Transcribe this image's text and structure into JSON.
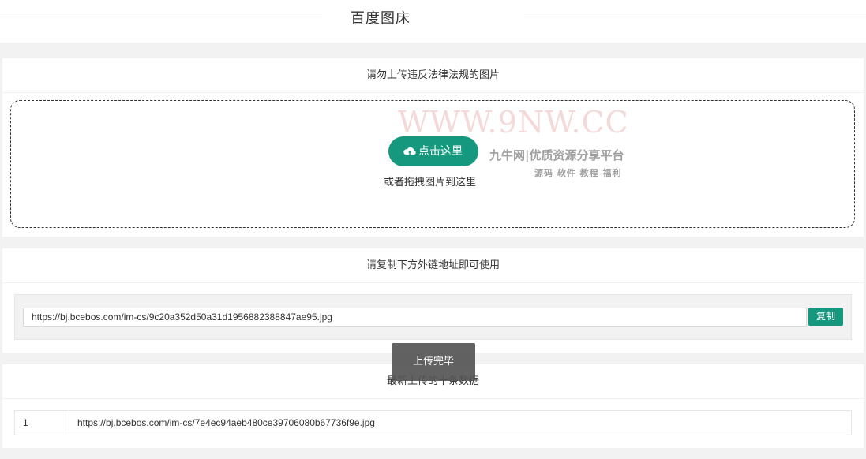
{
  "header": {
    "title": "百度图床"
  },
  "upload": {
    "notice": "请勿上传违反法律法规的图片",
    "button_label": "点击这里",
    "drag_hint": "或者拖拽图片到这里",
    "watermark_main": "WWW.9NW.CC",
    "watermark_sub": "九牛网|优质资源分享平台",
    "watermark_tags": "源码 软件 教程 福利"
  },
  "link": {
    "notice": "请复制下方外链地址即可使用",
    "url_value": "https://bj.bcebos.com/im-cs/9c20a352d50a31d1956882388847ae95.jpg",
    "copy_label": "复制"
  },
  "toast": {
    "message": "上传完毕"
  },
  "recent": {
    "title": "最新上传的十条数据",
    "rows": [
      {
        "index": "1",
        "url": "https://bj.bcebos.com/im-cs/7e4ec94aeb480ce39706080b67736f9e.jpg"
      }
    ]
  },
  "colors": {
    "accent": "#16987f",
    "toast_bg": "#555555"
  },
  "icons": {
    "upload": "cloud-upload-icon"
  }
}
